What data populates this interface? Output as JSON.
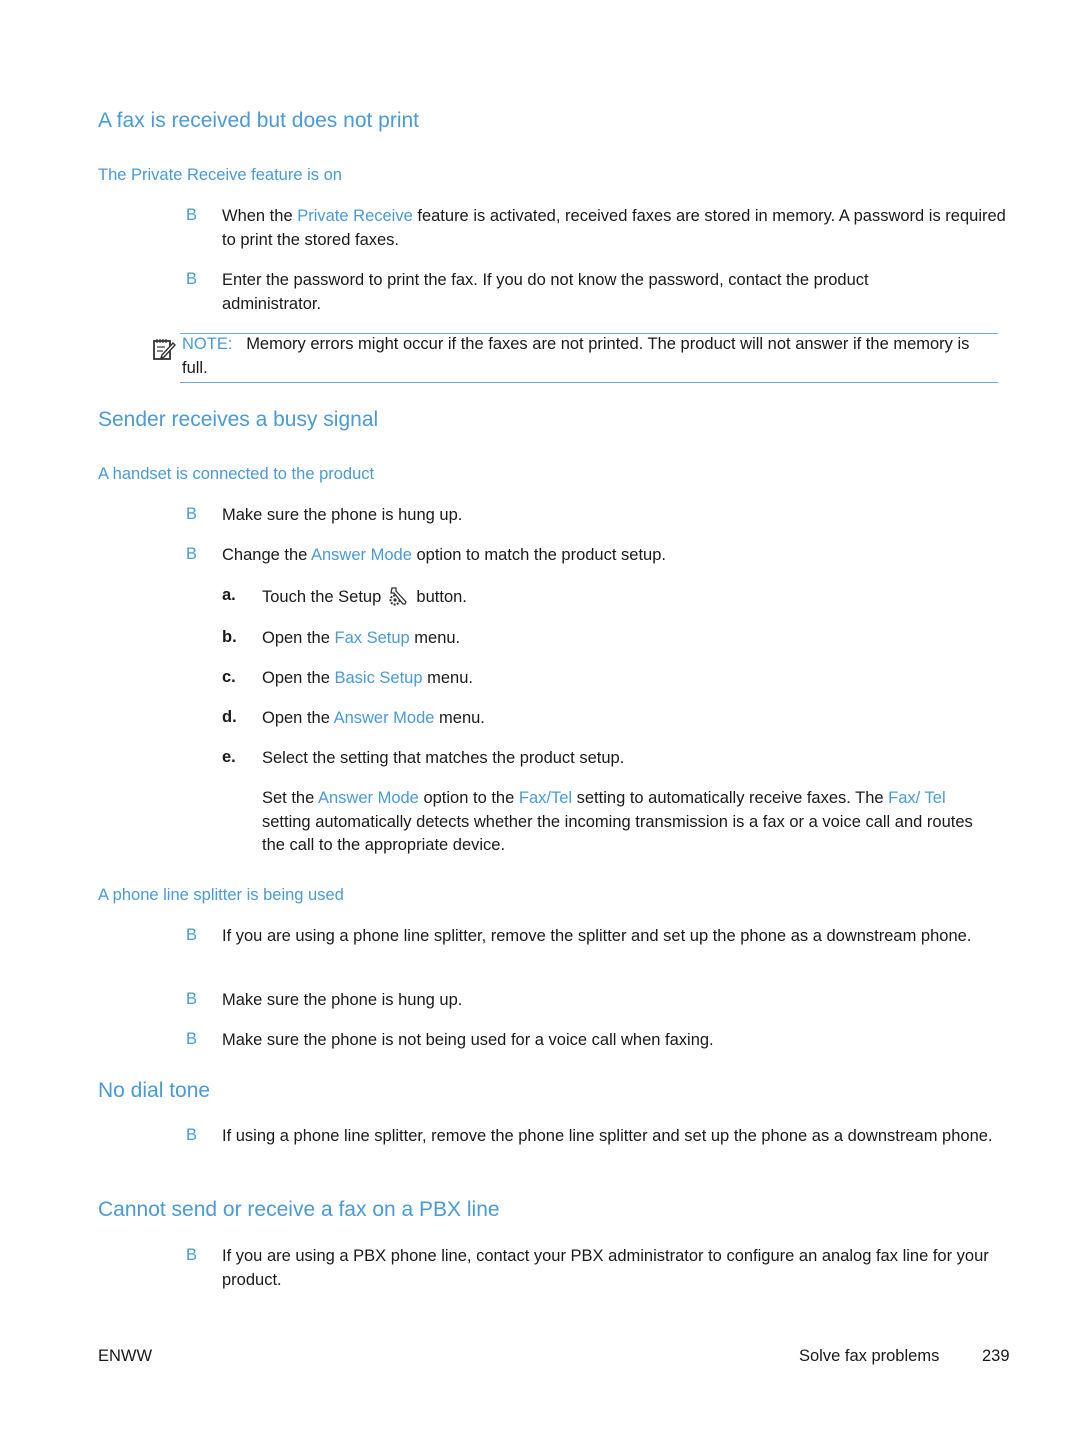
{
  "sections": [
    {
      "title": "A fax is received but does not print",
      "subsections": [
        {
          "title": "The Private Receive feature is on",
          "bullets": [
            {
              "parts": [
                "When the ",
                "Private Receive",
                " feature is activated, received faxes are stored in memory. A password is required to print the stored faxes."
              ]
            },
            {
              "text": "Enter the password to print the fax. If you do not know the password, contact the product administrator."
            }
          ],
          "note": {
            "label": "NOTE:",
            "text": "Memory errors might occur if the faxes are not printed. The product will not answer if the memory is full."
          }
        }
      ]
    },
    {
      "title": "Sender receives a busy signal",
      "subsections": [
        {
          "title": "A handset is connected to the product",
          "bullets": [
            {
              "text": "Make sure the phone is hung up."
            },
            {
              "parts": [
                "Change the ",
                "Answer Mode",
                " option to match the product setup."
              ]
            }
          ],
          "steps": [
            {
              "label": "a.",
              "parts": [
                "Touch the Setup ",
                " button."
              ],
              "icon": "setup-wrench-gear-icon"
            },
            {
              "label": "b.",
              "parts": [
                "Open the ",
                "Fax Setup",
                " menu."
              ]
            },
            {
              "label": "c.",
              "parts": [
                "Open the ",
                "Basic Setup",
                " menu."
              ]
            },
            {
              "label": "d.",
              "parts": [
                "Open the ",
                "Answer Mode",
                " menu."
              ]
            },
            {
              "label": "e.",
              "text": "Select the setting that matches the product setup."
            }
          ],
          "step_note": {
            "parts": [
              "Set the ",
              "Answer Mode",
              " option to the ",
              "Fax/Tel",
              " setting to automatically receive faxes. The ",
              "Fax/ Tel",
              " setting automatically detects whether the incoming transmission is a fax or a voice call and routes the call to the appropriate device."
            ]
          }
        },
        {
          "title": "A phone line splitter is being used",
          "bullets": [
            {
              "text": "If you are using a phone line splitter, remove the splitter and set up the phone as a downstream phone."
            },
            {
              "text": "Make sure the phone is hung up."
            },
            {
              "text": "Make sure the phone is not being used for a voice call when faxing."
            }
          ]
        }
      ]
    },
    {
      "title": "No dial tone",
      "bullets": [
        {
          "text": "If using a phone line splitter, remove the phone line splitter and set up the phone as a downstream phone."
        }
      ]
    },
    {
      "title": "Cannot send or receive a fax on a PBX line",
      "bullets": [
        {
          "text": "If you are using a PBX phone line, contact your PBX administrator to configure an analog fax line for your product."
        }
      ]
    }
  ],
  "bullet_glyph": "B",
  "footer": {
    "left": "ENWW",
    "section": "Solve fax problems",
    "page": "239"
  },
  "colors": {
    "accent": "#4a9ad8",
    "text": "#1a1a1a"
  }
}
